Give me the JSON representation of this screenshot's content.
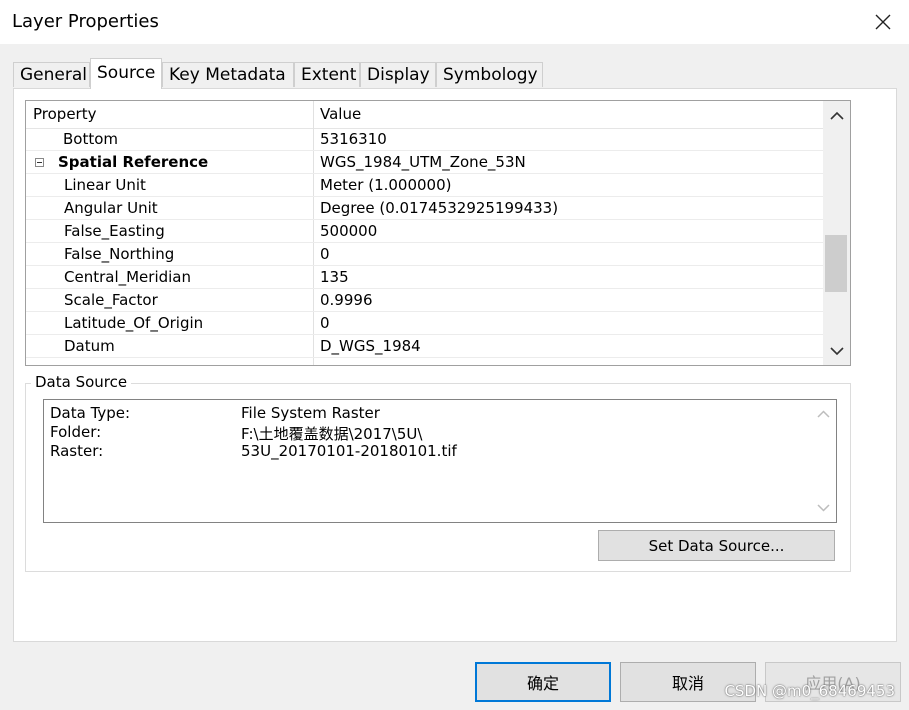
{
  "window": {
    "title": "Layer Properties"
  },
  "tabs": [
    {
      "label": "General"
    },
    {
      "label": "Source"
    },
    {
      "label": "Key Metadata"
    },
    {
      "label": "Extent"
    },
    {
      "label": "Display"
    },
    {
      "label": "Symbology"
    }
  ],
  "active_tab": "Source",
  "property_grid": {
    "headers": {
      "property": "Property",
      "value": "Value"
    },
    "rows": [
      {
        "property": "Bottom",
        "value": "5316310"
      },
      {
        "property": "Spatial Reference",
        "value": "WGS_1984_UTM_Zone_53N"
      },
      {
        "property": "Linear Unit",
        "value": "Meter (1.000000)"
      },
      {
        "property": "Angular Unit",
        "value": "Degree (0.0174532925199433)"
      },
      {
        "property": "False_Easting",
        "value": "500000"
      },
      {
        "property": "False_Northing",
        "value": "0"
      },
      {
        "property": "Central_Meridian",
        "value": "135"
      },
      {
        "property": "Scale_Factor",
        "value": "0.9996"
      },
      {
        "property": "Latitude_Of_Origin",
        "value": "0"
      },
      {
        "property": "Datum",
        "value": "D_WGS_1984"
      }
    ]
  },
  "data_source": {
    "group_label": "Data Source",
    "lines": [
      {
        "label": "Data Type:",
        "value": "File System Raster"
      },
      {
        "label": "Folder:",
        "value": "F:\\土地覆盖数据\\2017\\5U\\"
      },
      {
        "label": "Raster:",
        "value": "53U_20170101-20180101.tif"
      }
    ],
    "set_button": "Set Data Source..."
  },
  "buttons": {
    "ok": "确定",
    "cancel": "取消",
    "apply": "应用(A)"
  },
  "watermark": "CSDN @m0_68469453",
  "icons": {
    "close": "close-icon",
    "scroll_up": "chevron-up-icon",
    "scroll_down": "chevron-down-icon",
    "collapse": "collapse-minus-icon"
  },
  "colors": {
    "focus_border": "#0078d7",
    "window_bg": "#f0f0f0"
  }
}
